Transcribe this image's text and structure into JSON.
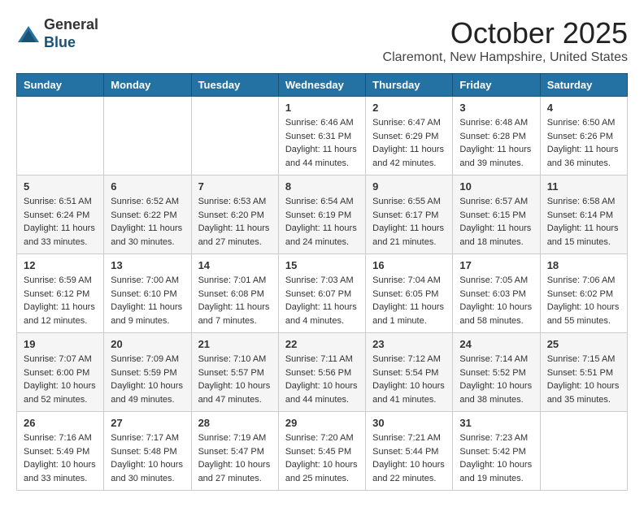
{
  "header": {
    "logo_general": "General",
    "logo_blue": "Blue",
    "month": "October 2025",
    "location": "Claremont, New Hampshire, United States"
  },
  "days_of_week": [
    "Sunday",
    "Monday",
    "Tuesday",
    "Wednesday",
    "Thursday",
    "Friday",
    "Saturday"
  ],
  "weeks": [
    [
      {
        "day": "",
        "info": ""
      },
      {
        "day": "",
        "info": ""
      },
      {
        "day": "",
        "info": ""
      },
      {
        "day": "1",
        "info": "Sunrise: 6:46 AM\nSunset: 6:31 PM\nDaylight: 11 hours\nand 44 minutes."
      },
      {
        "day": "2",
        "info": "Sunrise: 6:47 AM\nSunset: 6:29 PM\nDaylight: 11 hours\nand 42 minutes."
      },
      {
        "day": "3",
        "info": "Sunrise: 6:48 AM\nSunset: 6:28 PM\nDaylight: 11 hours\nand 39 minutes."
      },
      {
        "day": "4",
        "info": "Sunrise: 6:50 AM\nSunset: 6:26 PM\nDaylight: 11 hours\nand 36 minutes."
      }
    ],
    [
      {
        "day": "5",
        "info": "Sunrise: 6:51 AM\nSunset: 6:24 PM\nDaylight: 11 hours\nand 33 minutes."
      },
      {
        "day": "6",
        "info": "Sunrise: 6:52 AM\nSunset: 6:22 PM\nDaylight: 11 hours\nand 30 minutes."
      },
      {
        "day": "7",
        "info": "Sunrise: 6:53 AM\nSunset: 6:20 PM\nDaylight: 11 hours\nand 27 minutes."
      },
      {
        "day": "8",
        "info": "Sunrise: 6:54 AM\nSunset: 6:19 PM\nDaylight: 11 hours\nand 24 minutes."
      },
      {
        "day": "9",
        "info": "Sunrise: 6:55 AM\nSunset: 6:17 PM\nDaylight: 11 hours\nand 21 minutes."
      },
      {
        "day": "10",
        "info": "Sunrise: 6:57 AM\nSunset: 6:15 PM\nDaylight: 11 hours\nand 18 minutes."
      },
      {
        "day": "11",
        "info": "Sunrise: 6:58 AM\nSunset: 6:14 PM\nDaylight: 11 hours\nand 15 minutes."
      }
    ],
    [
      {
        "day": "12",
        "info": "Sunrise: 6:59 AM\nSunset: 6:12 PM\nDaylight: 11 hours\nand 12 minutes."
      },
      {
        "day": "13",
        "info": "Sunrise: 7:00 AM\nSunset: 6:10 PM\nDaylight: 11 hours\nand 9 minutes."
      },
      {
        "day": "14",
        "info": "Sunrise: 7:01 AM\nSunset: 6:08 PM\nDaylight: 11 hours\nand 7 minutes."
      },
      {
        "day": "15",
        "info": "Sunrise: 7:03 AM\nSunset: 6:07 PM\nDaylight: 11 hours\nand 4 minutes."
      },
      {
        "day": "16",
        "info": "Sunrise: 7:04 AM\nSunset: 6:05 PM\nDaylight: 11 hours\nand 1 minute."
      },
      {
        "day": "17",
        "info": "Sunrise: 7:05 AM\nSunset: 6:03 PM\nDaylight: 10 hours\nand 58 minutes."
      },
      {
        "day": "18",
        "info": "Sunrise: 7:06 AM\nSunset: 6:02 PM\nDaylight: 10 hours\nand 55 minutes."
      }
    ],
    [
      {
        "day": "19",
        "info": "Sunrise: 7:07 AM\nSunset: 6:00 PM\nDaylight: 10 hours\nand 52 minutes."
      },
      {
        "day": "20",
        "info": "Sunrise: 7:09 AM\nSunset: 5:59 PM\nDaylight: 10 hours\nand 49 minutes."
      },
      {
        "day": "21",
        "info": "Sunrise: 7:10 AM\nSunset: 5:57 PM\nDaylight: 10 hours\nand 47 minutes."
      },
      {
        "day": "22",
        "info": "Sunrise: 7:11 AM\nSunset: 5:56 PM\nDaylight: 10 hours\nand 44 minutes."
      },
      {
        "day": "23",
        "info": "Sunrise: 7:12 AM\nSunset: 5:54 PM\nDaylight: 10 hours\nand 41 minutes."
      },
      {
        "day": "24",
        "info": "Sunrise: 7:14 AM\nSunset: 5:52 PM\nDaylight: 10 hours\nand 38 minutes."
      },
      {
        "day": "25",
        "info": "Sunrise: 7:15 AM\nSunset: 5:51 PM\nDaylight: 10 hours\nand 35 minutes."
      }
    ],
    [
      {
        "day": "26",
        "info": "Sunrise: 7:16 AM\nSunset: 5:49 PM\nDaylight: 10 hours\nand 33 minutes."
      },
      {
        "day": "27",
        "info": "Sunrise: 7:17 AM\nSunset: 5:48 PM\nDaylight: 10 hours\nand 30 minutes."
      },
      {
        "day": "28",
        "info": "Sunrise: 7:19 AM\nSunset: 5:47 PM\nDaylight: 10 hours\nand 27 minutes."
      },
      {
        "day": "29",
        "info": "Sunrise: 7:20 AM\nSunset: 5:45 PM\nDaylight: 10 hours\nand 25 minutes."
      },
      {
        "day": "30",
        "info": "Sunrise: 7:21 AM\nSunset: 5:44 PM\nDaylight: 10 hours\nand 22 minutes."
      },
      {
        "day": "31",
        "info": "Sunrise: 7:23 AM\nSunset: 5:42 PM\nDaylight: 10 hours\nand 19 minutes."
      },
      {
        "day": "",
        "info": ""
      }
    ]
  ]
}
